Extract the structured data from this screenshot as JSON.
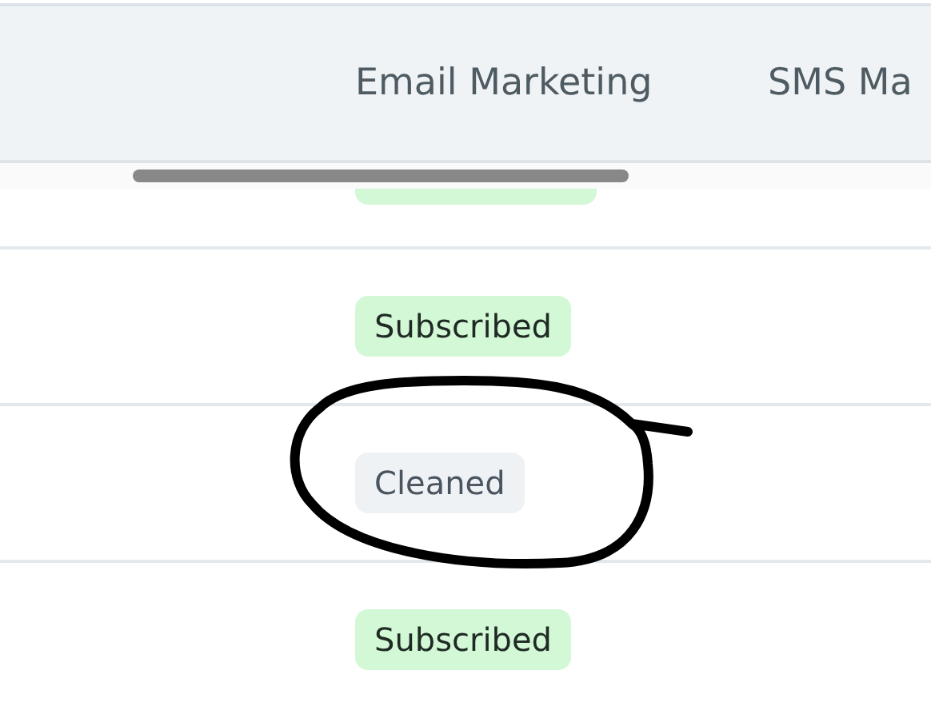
{
  "table": {
    "columns": [
      {
        "label": "Email Marketing"
      },
      {
        "label": "SMS Ma"
      }
    ],
    "rows": [
      {
        "status": {
          "kind": "subscribed"
        }
      },
      {
        "status": {
          "kind": "subscribed",
          "label": "Subscribed"
        }
      },
      {
        "status": {
          "kind": "cleaned",
          "label": "Cleaned"
        }
      },
      {
        "status": {
          "kind": "subscribed",
          "label": "Subscribed"
        }
      }
    ]
  },
  "annotation": {
    "kind": "circle"
  }
}
